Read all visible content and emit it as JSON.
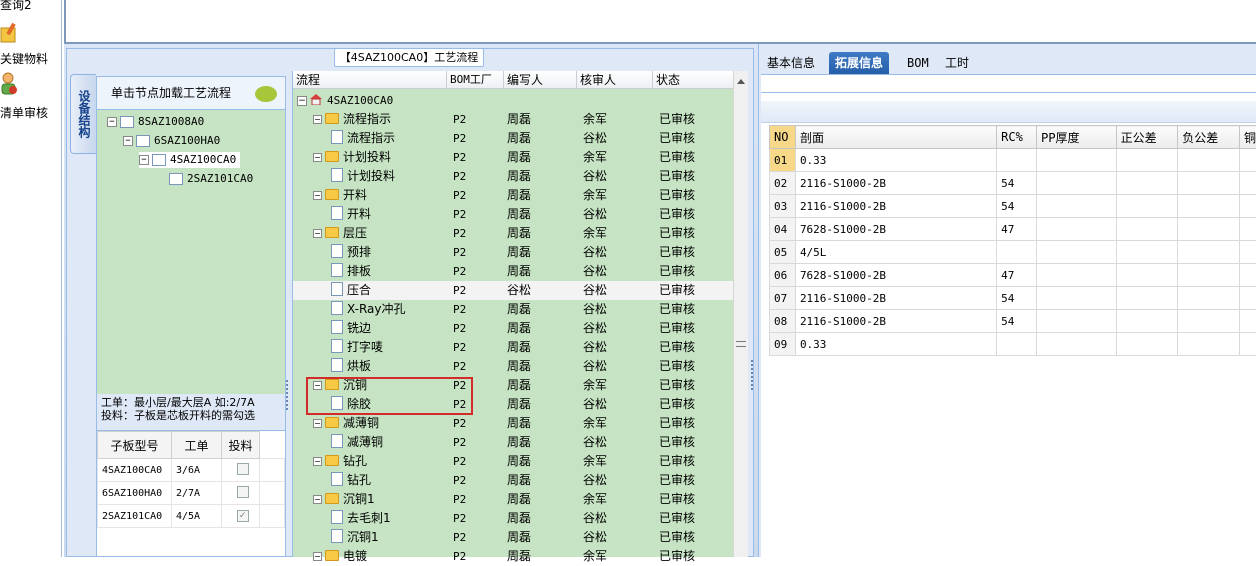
{
  "left_nav": {
    "items": [
      "查询2",
      "关键物料",
      "清单审核"
    ]
  },
  "middle": {
    "title": "【4SAZ100CA0】工艺流程",
    "vertical_tab": "设备结构",
    "tree_header": "单击节点加载工艺流程",
    "tree_nodes": [
      "8SAZ1008A0",
      "6SAZ100HA0",
      "4SAZ100CA0",
      "2SAZ101CA0"
    ],
    "info_line1": "工单：最小层/最大层A 如:2/7A",
    "info_line2": "投料：子板是芯板开料的需勾选",
    "sub_table": {
      "headers": [
        "子板型号",
        "工单",
        "投料"
      ],
      "rows": [
        {
          "model": "4SAZ100CA0",
          "order": "3/6A",
          "feed": false
        },
        {
          "model": "6SAZ100HA0",
          "order": "2/7A",
          "feed": false
        },
        {
          "model": "2SAZ101CA0",
          "order": "4/5A",
          "feed": true
        }
      ]
    },
    "flow_headers": [
      "流程",
      "BOM工厂",
      "编写人",
      "核审人",
      "状态"
    ],
    "flow_root": "4SAZ100CA0",
    "flow_rows": [
      {
        "name": "流程指示",
        "type": "folder",
        "bom": "P2",
        "writer": "周磊",
        "reviewer": "余军",
        "status": "已审核"
      },
      {
        "name": "流程指示",
        "type": "doc",
        "bom": "P2",
        "writer": "周磊",
        "reviewer": "谷松",
        "status": "已审核"
      },
      {
        "name": "计划投料",
        "type": "folder",
        "bom": "P2",
        "writer": "周磊",
        "reviewer": "余军",
        "status": "已审核"
      },
      {
        "name": "计划投料",
        "type": "doc",
        "bom": "P2",
        "writer": "周磊",
        "reviewer": "谷松",
        "status": "已审核"
      },
      {
        "name": "开料",
        "type": "folder",
        "bom": "P2",
        "writer": "周磊",
        "reviewer": "余军",
        "status": "已审核"
      },
      {
        "name": "开料",
        "type": "doc",
        "bom": "P2",
        "writer": "周磊",
        "reviewer": "谷松",
        "status": "已审核"
      },
      {
        "name": "层压",
        "type": "folder",
        "bom": "P2",
        "writer": "周磊",
        "reviewer": "余军",
        "status": "已审核"
      },
      {
        "name": "预排",
        "type": "doc",
        "bom": "P2",
        "writer": "周磊",
        "reviewer": "谷松",
        "status": "已审核"
      },
      {
        "name": "排板",
        "type": "doc",
        "bom": "P2",
        "writer": "周磊",
        "reviewer": "谷松",
        "status": "已审核"
      },
      {
        "name": "压合",
        "type": "doc",
        "bom": "P2",
        "writer": "谷松",
        "reviewer": "谷松",
        "status": "已审核",
        "selected": true
      },
      {
        "name": "X-Ray冲孔",
        "type": "doc",
        "bom": "P2",
        "writer": "周磊",
        "reviewer": "谷松",
        "status": "已审核"
      },
      {
        "name": "铣边",
        "type": "doc",
        "bom": "P2",
        "writer": "周磊",
        "reviewer": "谷松",
        "status": "已审核"
      },
      {
        "name": "打字唛",
        "type": "doc",
        "bom": "P2",
        "writer": "周磊",
        "reviewer": "谷松",
        "status": "已审核"
      },
      {
        "name": "烘板",
        "type": "doc",
        "bom": "P2",
        "writer": "周磊",
        "reviewer": "谷松",
        "status": "已审核"
      },
      {
        "name": "沉铜",
        "type": "folder",
        "bom": "P2",
        "writer": "周磊",
        "reviewer": "余军",
        "status": "已审核"
      },
      {
        "name": "除胶",
        "type": "doc",
        "bom": "P2",
        "writer": "周磊",
        "reviewer": "谷松",
        "status": "已审核"
      },
      {
        "name": "减薄铜",
        "type": "folder",
        "bom": "P2",
        "writer": "周磊",
        "reviewer": "余军",
        "status": "已审核"
      },
      {
        "name": "减薄铜",
        "type": "doc",
        "bom": "P2",
        "writer": "周磊",
        "reviewer": "谷松",
        "status": "已审核"
      },
      {
        "name": "钻孔",
        "type": "folder",
        "bom": "P2",
        "writer": "周磊",
        "reviewer": "余军",
        "status": "已审核"
      },
      {
        "name": "钻孔",
        "type": "doc",
        "bom": "P2",
        "writer": "周磊",
        "reviewer": "谷松",
        "status": "已审核"
      },
      {
        "name": "沉铜1",
        "type": "folder",
        "bom": "P2",
        "writer": "周磊",
        "reviewer": "余军",
        "status": "已审核"
      },
      {
        "name": "去毛刺1",
        "type": "doc",
        "bom": "P2",
        "writer": "周磊",
        "reviewer": "谷松",
        "status": "已审核"
      },
      {
        "name": "沉铜1",
        "type": "doc",
        "bom": "P2",
        "writer": "周磊",
        "reviewer": "谷松",
        "status": "已审核"
      },
      {
        "name": "电镀",
        "type": "folder",
        "bom": "P2",
        "writer": "周磊",
        "reviewer": "余军",
        "status": "已审核"
      }
    ]
  },
  "right": {
    "tabs": [
      "基本信息",
      "拓展信息",
      "BOM",
      "工时"
    ],
    "active_tab": "拓展信息",
    "grid_headers": [
      "NO",
      "剖面",
      "RC%",
      "PP厚度",
      "正公差",
      "负公差",
      "铜"
    ],
    "grid_rows": [
      {
        "no": "01",
        "profile": "0.33",
        "rc": ""
      },
      {
        "no": "02",
        "profile": "2116-S1000-2B",
        "rc": "54"
      },
      {
        "no": "03",
        "profile": "2116-S1000-2B",
        "rc": "54"
      },
      {
        "no": "04",
        "profile": "7628-S1000-2B",
        "rc": "47"
      },
      {
        "no": "05",
        "profile": "4/5L",
        "rc": ""
      },
      {
        "no": "06",
        "profile": "7628-S1000-2B",
        "rc": "47"
      },
      {
        "no": "07",
        "profile": "2116-S1000-2B",
        "rc": "54"
      },
      {
        "no": "08",
        "profile": "2116-S1000-2B",
        "rc": "54"
      },
      {
        "no": "09",
        "profile": "0.33",
        "rc": ""
      }
    ]
  },
  "colors": {
    "tree_green": "#c6e4c3",
    "panel_blue": "#dfe8f6",
    "active_tab": "#2f6db8",
    "highlight_red": "#d32a2a",
    "no_header": "#f7d889"
  }
}
